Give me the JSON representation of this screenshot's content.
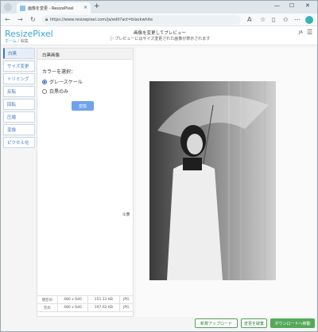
{
  "browser": {
    "tab_title": "画像を変更 - ResizePixel",
    "tab_close": "×",
    "new_tab": "+",
    "url": "https://www.resizepixel.com/ja/edit?act=blackwhite",
    "win_min": "—",
    "win_max": "☐",
    "win_close": "✕"
  },
  "header": {
    "logo": "ResizePixel",
    "breadcrumb_home": "ホーム",
    "breadcrumb_sep": " / ",
    "breadcrumb_current": "編集",
    "title": "画像を変更してプレビュー",
    "subtitle": "ⓘ プレビューにはサイズ変更された画像が表示されます",
    "lang": "JA"
  },
  "sidebar": {
    "items": [
      {
        "label": "白黒"
      },
      {
        "label": "サイズ変更"
      },
      {
        "label": "トリミング"
      },
      {
        "label": "反転"
      },
      {
        "label": "回転"
      },
      {
        "label": "圧縮"
      },
      {
        "label": "変換"
      },
      {
        "label": "ピクセル化"
      }
    ]
  },
  "panel": {
    "heading": "白黒画像",
    "color_label": "カラーを選択：",
    "option_grayscale": "グレースケール",
    "option_bw": "白黒のみ",
    "convert_button": "変換",
    "zoom_label": "①表"
  },
  "sizes": {
    "rows": [
      {
        "label": "現在の",
        "dims": "480 x 640",
        "size": "151.11 KB",
        "format": "JPG"
      },
      {
        "label": "元の",
        "dims": "480 x 640",
        "size": "197.62 KB",
        "format": "JPG"
      }
    ]
  },
  "actions": {
    "new_upload": "新規アップロード",
    "reset": "変更を破棄",
    "download": "ダウンロードへ移動"
  },
  "colors": {
    "accent": "#3a78c2",
    "logo": "#3aa3d9",
    "green": "#54a95a"
  }
}
